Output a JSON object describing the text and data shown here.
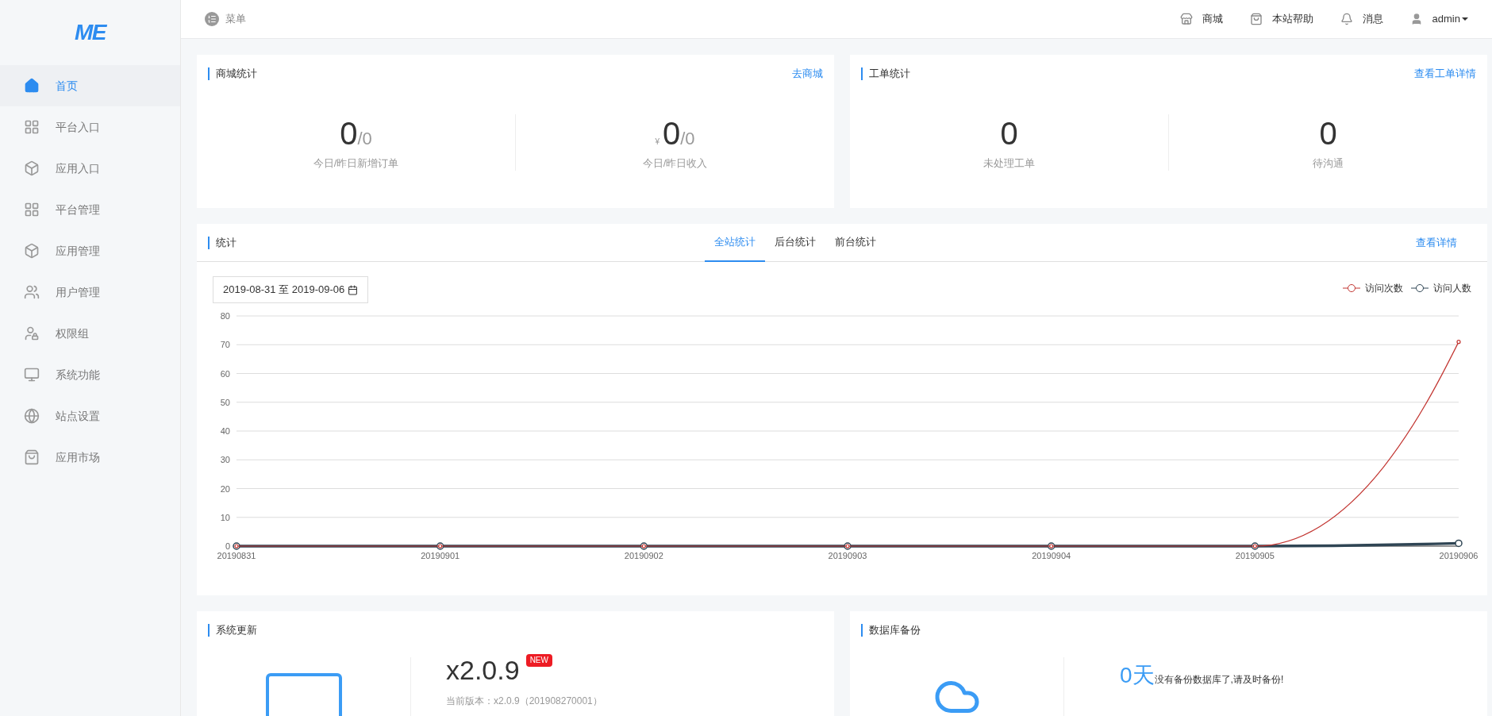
{
  "sidebar": {
    "logo": "ME",
    "items": [
      {
        "label": "首页",
        "selected": true
      },
      {
        "label": "平台入口",
        "selected": false
      },
      {
        "label": "应用入口",
        "selected": false
      },
      {
        "label": "平台管理",
        "selected": false
      },
      {
        "label": "应用管理",
        "selected": false
      },
      {
        "label": "用户管理",
        "selected": false
      },
      {
        "label": "权限组",
        "selected": false
      },
      {
        "label": "系统功能",
        "selected": false
      },
      {
        "label": "站点设置",
        "selected": false
      },
      {
        "label": "应用市场",
        "selected": false
      }
    ]
  },
  "header": {
    "menu": "菜单",
    "links": [
      {
        "label": "商城"
      },
      {
        "label": "本站帮助"
      },
      {
        "label": "消息"
      }
    ],
    "user": "admin"
  },
  "shop_stats": {
    "title": "商城统计",
    "link": "去商城",
    "stats": [
      {
        "value": "0",
        "previous": "/0",
        "label": "今日/昨日新增订单"
      },
      {
        "currency": "¥",
        "value": "0",
        "previous": "/0",
        "label": "今日/昨日收入"
      }
    ]
  },
  "ticket_stats": {
    "title": "工单统计",
    "link": "查看工单详情",
    "stats": [
      {
        "value": "0",
        "label": "未处理工单"
      },
      {
        "value": "0",
        "label": "待沟通"
      }
    ]
  },
  "statistics": {
    "title": "统计",
    "tabs": [
      {
        "label": "全站统计",
        "selected": true
      },
      {
        "label": "后台统计",
        "selected": false
      },
      {
        "label": "前台统计",
        "selected": false
      }
    ],
    "link": "查看详情",
    "date_range": "2019-08-31 至 2019-09-06",
    "chart_data": {
      "type": "line",
      "grid": true,
      "categories": [
        "20190831",
        "20190901",
        "20190902",
        "20190903",
        "20190904",
        "20190905",
        "20190906"
      ],
      "ylim": [
        0,
        80
      ],
      "yticks": [
        0,
        10,
        20,
        30,
        40,
        50,
        60,
        70,
        80
      ],
      "series": [
        {
          "name": "访问次数",
          "color": "#c23531",
          "marker": true,
          "values": [
            0,
            0,
            0,
            0,
            0,
            0,
            71
          ]
        },
        {
          "name": "访问人数",
          "color": "#2f4554",
          "marker": true,
          "values": [
            0,
            0,
            0,
            0,
            0,
            0,
            1
          ]
        }
      ]
    }
  },
  "system_update": {
    "title": "系统更新",
    "version": "x2.0.9",
    "badge": "NEW",
    "current": "当前版本：x2.0.9（201908270001）"
  },
  "db_backup": {
    "title": "数据库备份",
    "days": "0天",
    "message": "没有备份数据库了,请及时备份!"
  }
}
